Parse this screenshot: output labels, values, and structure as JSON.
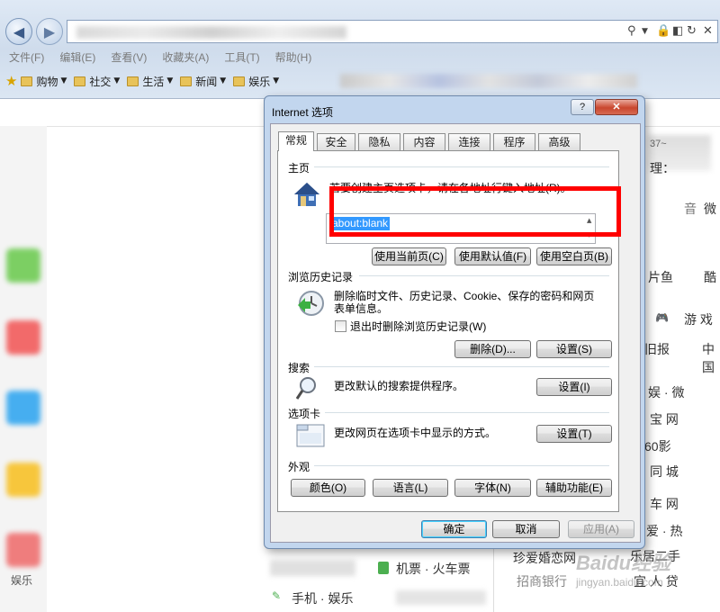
{
  "browser": {
    "menu": [
      "文件(F)",
      "编辑(E)",
      "查看(V)",
      "收藏夹(A)",
      "工具(T)",
      "帮助(H)"
    ],
    "favorites": [
      "购物",
      "社交",
      "生活",
      "新闻",
      "娱乐"
    ]
  },
  "background": {
    "items": [
      "37~",
      "理：",
      "音",
      "微",
      "片鱼",
      "酷",
      "游 戏",
      "旧报",
      "中国",
      "娱 · 微",
      "宝 网",
      "60影",
      "同 城",
      "车 网",
      "爱 · 热",
      "乐居二手",
      "机票 · 火车票",
      "手机 · 娱乐",
      "珍爱婚恋网",
      "招商银行",
      "宜 人 贷",
      "娱乐"
    ]
  },
  "dialog": {
    "title": "Internet 选项",
    "help_label": "?",
    "close_label": "✕",
    "tabs": [
      "常规",
      "安全",
      "隐私",
      "内容",
      "连接",
      "程序",
      "高级"
    ],
    "home": {
      "group_label": "主页",
      "description": "若要创建主页选项卡，请在各地址行键入地址(R)。",
      "url": "about:blank",
      "buttons": [
        "使用当前页(C)",
        "使用默认值(F)",
        "使用空白页(B)"
      ]
    },
    "history": {
      "group_label": "浏览历史记录",
      "description": "删除临时文件、历史记录、Cookie、保存的密码和网页表单信息。",
      "checkbox_label": "退出时删除浏览历史记录(W)",
      "delete_label": "删除(D)...",
      "settings_label": "设置(S)"
    },
    "search": {
      "group_label": "搜索",
      "description": "更改默认的搜索提供程序。",
      "settings_label": "设置(I)"
    },
    "tabs_group": {
      "group_label": "选项卡",
      "description": "更改网页在选项卡中显示的方式。",
      "settings_label": "设置(T)"
    },
    "appearance": {
      "group_label": "外观",
      "buttons": [
        "颜色(O)",
        "语言(L)",
        "字体(N)",
        "辅助功能(E)"
      ]
    },
    "footer": {
      "ok": "确定",
      "cancel": "取消",
      "apply": "应用(A)"
    }
  },
  "watermark": {
    "brand": "Baidu经验",
    "url": "jingyan.baidu.com"
  },
  "colors": {
    "highlight": "#ff0000",
    "selection": "#3399ff"
  }
}
